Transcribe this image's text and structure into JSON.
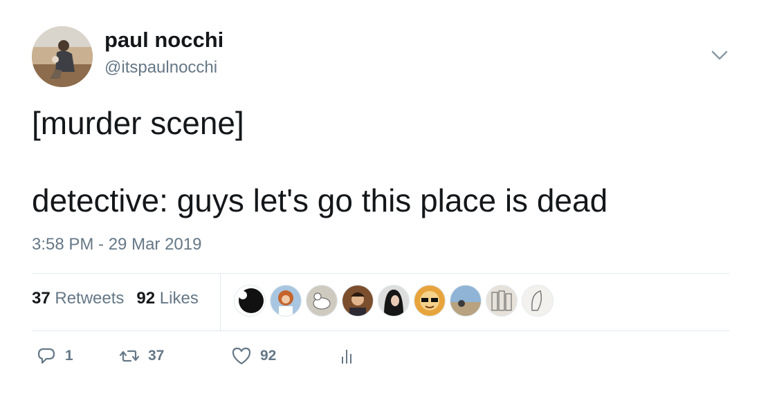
{
  "author": {
    "name": "paul nocchi",
    "handle": "@itspaulnocchi"
  },
  "tweet": {
    "text": "[murder scene]\n\ndetective: guys let's go this place is dead",
    "timestamp": "3:58 PM - 29 Mar 2019"
  },
  "stats": {
    "retweets_count": "37",
    "retweets_label": "Retweets",
    "likes_count": "92",
    "likes_label": "Likes"
  },
  "likers": [
    {
      "icon": "liker-avatar-1"
    },
    {
      "icon": "liker-avatar-2"
    },
    {
      "icon": "liker-avatar-3"
    },
    {
      "icon": "liker-avatar-4"
    },
    {
      "icon": "liker-avatar-5"
    },
    {
      "icon": "liker-avatar-6"
    },
    {
      "icon": "liker-avatar-7"
    },
    {
      "icon": "liker-avatar-8"
    },
    {
      "icon": "liker-avatar-9"
    }
  ],
  "actions": {
    "reply_count": "1",
    "retweet_count": "37",
    "like_count": "92"
  },
  "colors": {
    "text": "#14171a",
    "secondary": "#657786",
    "divider": "#e1e8ed"
  }
}
